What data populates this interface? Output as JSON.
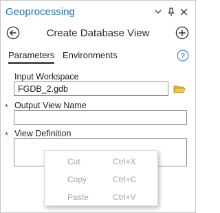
{
  "pane": {
    "title": "Geoprocessing",
    "controls": {
      "menu_icon": "chevron-down-icon",
      "pin_icon": "pin-icon",
      "close_icon": "close-icon"
    }
  },
  "header": {
    "back_icon": "back-arrow-icon",
    "tool_title": "Create Database View",
    "add_icon": "add-icon"
  },
  "tabs": [
    {
      "label": "Parameters",
      "active": true
    },
    {
      "label": "Environments",
      "active": false
    }
  ],
  "help_icon": "help-icon",
  "params": {
    "input_workspace": {
      "label": "Input Workspace",
      "value": "FGDB_2.gdb",
      "required": false,
      "browse_icon": "folder-icon"
    },
    "output_view_name": {
      "label": "Output View Name",
      "value": "",
      "required": true
    },
    "view_definition": {
      "label": "View Definition",
      "value": "",
      "required": true
    },
    "required_marker": "*"
  },
  "context_menu": {
    "items": [
      {
        "label": "Cut",
        "shortcut": "Ctrl+X",
        "enabled": false
      },
      {
        "label": "Copy",
        "shortcut": "Ctrl+C",
        "enabled": false
      },
      {
        "label": "Paste",
        "shortcut": "Ctrl+V",
        "enabled": false
      }
    ]
  },
  "colors": {
    "title": "#1a6fb5",
    "required": "#c8202a",
    "disabled_text": "#a4a4a4",
    "help": "#4a90d9",
    "folder": "#e3b341"
  }
}
